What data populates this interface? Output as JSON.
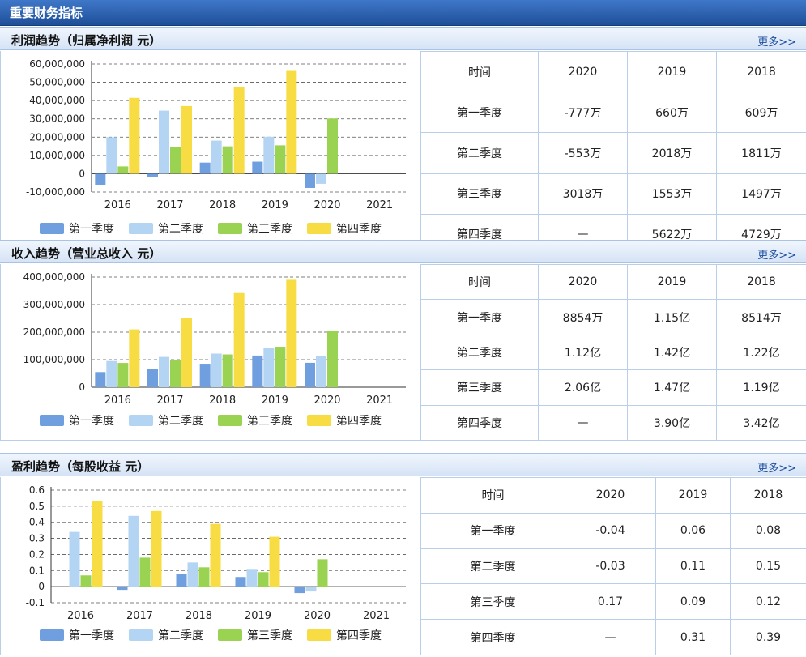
{
  "page_title": "重要财务指标",
  "more_label": "更多>>",
  "legend": [
    "第一季度",
    "第二季度",
    "第三季度",
    "第四季度"
  ],
  "colors": {
    "q1": "#6f9fde",
    "q2": "#b3d4f2",
    "q3": "#9ad352",
    "q4": "#f7dc43"
  },
  "sections": [
    {
      "title": "利润趋势（归属净利润 元）",
      "table": {
        "header": [
          "时间",
          "2020",
          "2019",
          "2018"
        ],
        "rows": [
          [
            "第一季度",
            "-777万",
            "660万",
            "609万"
          ],
          [
            "第二季度",
            "-553万",
            "2018万",
            "1811万"
          ],
          [
            "第三季度",
            "3018万",
            "1553万",
            "1497万"
          ],
          [
            "第四季度",
            "—",
            "5622万",
            "4729万"
          ]
        ]
      }
    },
    {
      "title": "收入趋势（营业总收入 元）",
      "table": {
        "header": [
          "时间",
          "2020",
          "2019",
          "2018"
        ],
        "rows": [
          [
            "第一季度",
            "8854万",
            "1.15亿",
            "8514万"
          ],
          [
            "第二季度",
            "1.12亿",
            "1.42亿",
            "1.22亿"
          ],
          [
            "第三季度",
            "2.06亿",
            "1.47亿",
            "1.19亿"
          ],
          [
            "第四季度",
            "—",
            "3.90亿",
            "3.42亿"
          ]
        ]
      }
    },
    {
      "title": "盈利趋势（每股收益 元）",
      "table": {
        "header": [
          "时间",
          "2020",
          "2019",
          "2018"
        ],
        "rows": [
          [
            "第一季度",
            "-0.04",
            "0.06",
            "0.08"
          ],
          [
            "第二季度",
            "-0.03",
            "0.11",
            "0.15"
          ],
          [
            "第三季度",
            "0.17",
            "0.09",
            "0.12"
          ],
          [
            "第四季度",
            "—",
            "0.31",
            "0.39"
          ]
        ]
      }
    }
  ],
  "chart_data": [
    {
      "type": "bar",
      "categories": [
        "2016",
        "2017",
        "2018",
        "2019",
        "2020",
        "2021"
      ],
      "ylim": [
        -10000000,
        60000000
      ],
      "yticks": [
        60000000,
        50000000,
        40000000,
        30000000,
        20000000,
        10000000,
        0,
        -10000000
      ],
      "ytick_labels": [
        "60,000,000",
        "50,000,000",
        "40,000,000",
        "30,000,000",
        "20,000,000",
        "10,000,000",
        "0",
        "-10,000,000"
      ],
      "grid": true,
      "legend_position": "bottom",
      "series": [
        {
          "name": "第一季度",
          "values": [
            -6000000,
            -2000000,
            6090000,
            6600000,
            -7770000,
            null
          ]
        },
        {
          "name": "第二季度",
          "values": [
            20000000,
            34500000,
            18110000,
            20180000,
            -5530000,
            null
          ]
        },
        {
          "name": "第三季度",
          "values": [
            4000000,
            14500000,
            14970000,
            15530000,
            30180000,
            null
          ]
        },
        {
          "name": "第四季度",
          "values": [
            41500000,
            37000000,
            47290000,
            56220000,
            null,
            null
          ]
        }
      ]
    },
    {
      "type": "bar",
      "categories": [
        "2016",
        "2017",
        "2018",
        "2019",
        "2020",
        "2021"
      ],
      "ylim": [
        0,
        400000000
      ],
      "yticks": [
        400000000,
        300000000,
        200000000,
        100000000,
        0
      ],
      "ytick_labels": [
        "400,000,000",
        "300,000,000",
        "200,000,000",
        "100,000,000",
        "0"
      ],
      "grid": true,
      "legend_position": "bottom",
      "series": [
        {
          "name": "第一季度",
          "values": [
            55000000,
            65000000,
            85140000,
            115000000,
            88540000,
            null
          ]
        },
        {
          "name": "第二季度",
          "values": [
            95000000,
            110000000,
            122000000,
            142000000,
            112000000,
            null
          ]
        },
        {
          "name": "第三季度",
          "values": [
            88000000,
            98000000,
            119000000,
            147000000,
            206000000,
            null
          ]
        },
        {
          "name": "第四季度",
          "values": [
            210000000,
            250000000,
            342000000,
            390000000,
            null,
            null
          ]
        }
      ]
    },
    {
      "type": "bar",
      "categories": [
        "2016",
        "2017",
        "2018",
        "2019",
        "2020",
        "2021"
      ],
      "ylim": [
        -0.1,
        0.6
      ],
      "yticks": [
        0.6,
        0.5,
        0.4,
        0.3,
        0.2,
        0.1,
        0,
        -0.1
      ],
      "ytick_labels": [
        "0.6",
        "0.5",
        "0.4",
        "0.3",
        "0.2",
        "0.1",
        "0",
        "-0.1"
      ],
      "grid": true,
      "legend_position": "bottom",
      "series": [
        {
          "name": "第一季度",
          "values": [
            null,
            -0.02,
            0.08,
            0.06,
            -0.04,
            null
          ]
        },
        {
          "name": "第二季度",
          "values": [
            0.34,
            0.44,
            0.15,
            0.11,
            -0.03,
            null
          ]
        },
        {
          "name": "第三季度",
          "values": [
            0.07,
            0.18,
            0.12,
            0.09,
            0.17,
            null
          ]
        },
        {
          "name": "第四季度",
          "values": [
            0.53,
            0.47,
            0.39,
            0.31,
            null,
            null
          ]
        }
      ]
    }
  ]
}
